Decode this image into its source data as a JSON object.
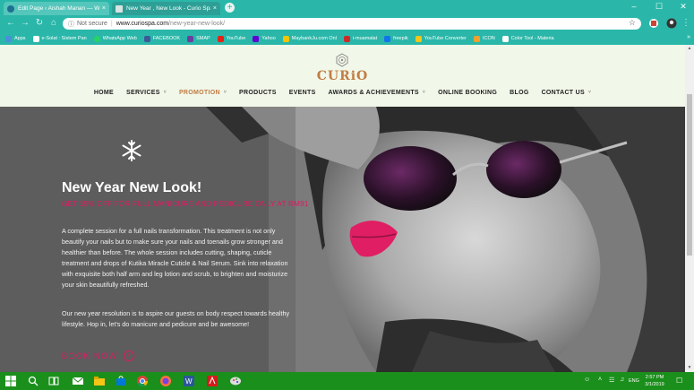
{
  "browser": {
    "tabs": [
      {
        "title": "Edit Page ‹ Aishah Manan — Wo",
        "close": "×"
      },
      {
        "title": "New Year , New Look - Curio Spa",
        "close": "×"
      }
    ],
    "new_tab": "+",
    "window_controls": {
      "minimize": "–",
      "maximize": "☐",
      "close": "✕"
    },
    "nav": {
      "back": "←",
      "forward": "→",
      "reload": "↻",
      "home": "⌂"
    },
    "address": {
      "info": "ⓘ",
      "security_label": "Not secure",
      "separator": "|",
      "host": "www.curiospa.com",
      "path": "/new-year-new-look/",
      "star": "☆"
    },
    "bookmarks": [
      {
        "label": "Apps",
        "color": "#4a90d9"
      },
      {
        "label": "e-Solat : Sistem Pan",
        "color": "#ffffff"
      },
      {
        "label": "WhatsApp Web",
        "color": "#25d366"
      },
      {
        "label": "FACEBOOK",
        "color": "#3b5998"
      },
      {
        "label": "SMAP",
        "color": "#6a3fa0"
      },
      {
        "label": "YouTube",
        "color": "#e62117"
      },
      {
        "label": "Yahoo",
        "color": "#5f01d1"
      },
      {
        "label": "MaybankJu.com Onl",
        "color": "#f4c400"
      },
      {
        "label": "i-muamalat",
        "color": "#cc2a2a"
      },
      {
        "label": "freepik",
        "color": "#1273eb"
      },
      {
        "label": "YouTube Converter",
        "color": "#f5c518"
      },
      {
        "label": "ICON",
        "color": "#f0a030"
      },
      {
        "label": "Color Tool - Materia",
        "color": "#ffffff"
      }
    ],
    "bookmarks_more": "»"
  },
  "site": {
    "logo_text": "CURiO",
    "nav": [
      {
        "label": "HOME",
        "dropdown": false,
        "active": false
      },
      {
        "label": "SERVICES",
        "dropdown": true,
        "active": false
      },
      {
        "label": "PROMOTION",
        "dropdown": true,
        "active": true
      },
      {
        "label": "PRODUCTS",
        "dropdown": false,
        "active": false
      },
      {
        "label": "EVENTS",
        "dropdown": false,
        "active": false
      },
      {
        "label": "AWARDS & ACHIEVEMENTS",
        "dropdown": true,
        "active": false
      },
      {
        "label": "ONLINE BOOKING",
        "dropdown": false,
        "active": false
      },
      {
        "label": "BLOG",
        "dropdown": false,
        "active": false
      },
      {
        "label": "CONTACT US",
        "dropdown": true,
        "active": false
      }
    ],
    "caret": "˅",
    "accent_color": "#c17c44",
    "highlight_color": "#e0185e"
  },
  "hero": {
    "icon": "❄",
    "title": "New Year New Look!",
    "subtitle": "GET 15% OFF FOR FULL MANICURE AND PEDICURE ONLY AT RM91",
    "paragraph_1": "A complete session for a full nails transformation. This treatment is not only beautify your nails but to make sure your nails and toenails grow stronger and healthier than before. The whole session includes cutting, shaping, cuticle treatment and drops of Kutika Miracle Cuticle & Nail Serum. Sink into relaxation with exquisite both half arm and leg lotion and scrub, to brighten and moisturize your skin beautifully refreshed.",
    "paragraph_2": "Our new year resolution is to aspire our guests on body respect towards healthy lifestyle. Hop in, let's do manicure and pedicure and be awesome!",
    "cta": "BOOK NOW",
    "cta_arrow": "›"
  },
  "taskbar": {
    "apps": [
      "search-icon",
      "task-view-icon",
      "mail-icon",
      "file-explorer-icon",
      "store-icon",
      "chrome-icon",
      "firefox-icon",
      "edge-icon",
      "word-icon",
      "acrobat-icon",
      "paint-icon"
    ],
    "tray": {
      "people": "☺",
      "chevron": "˄",
      "network": "☲",
      "volume": "♫",
      "lang": "ENG"
    },
    "time": "2:57 PM",
    "date": "3/1/2019",
    "notifications": "☐"
  }
}
